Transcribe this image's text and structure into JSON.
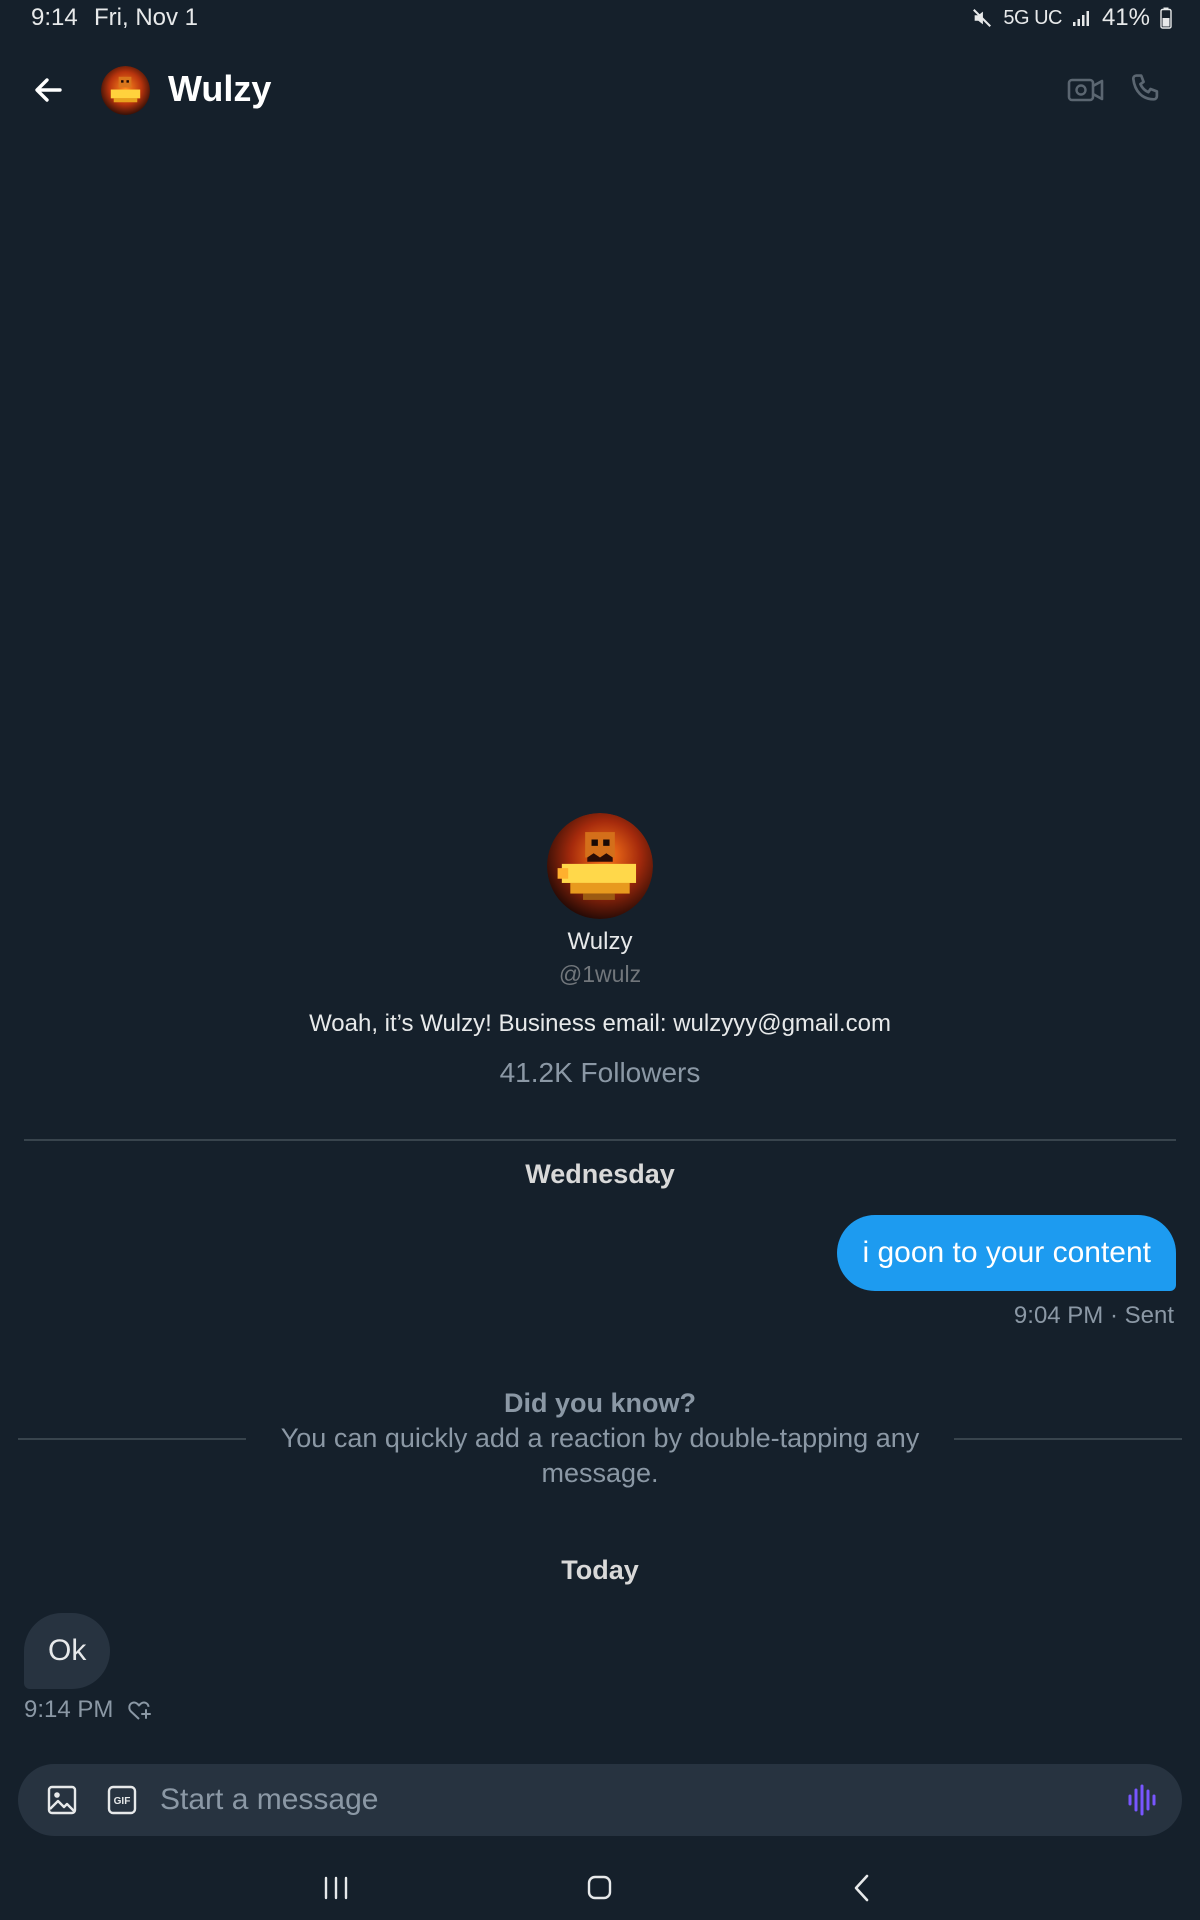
{
  "status_bar": {
    "time": "9:14",
    "date": "Fri, Nov 1",
    "network": "5G UC",
    "battery": "41%",
    "icons": [
      "mute-icon",
      "signal-icon",
      "battery-icon"
    ]
  },
  "header": {
    "title": "Wulzy",
    "icons": [
      "back-arrow-icon",
      "video-camera-icon",
      "phone-icon"
    ]
  },
  "profile": {
    "name": "Wulzy",
    "handle": "@1wulz",
    "bio": "Woah, it’s Wulzy! Business email: wulzyyy@gmail.com",
    "followers": "41.2K Followers"
  },
  "conversation": {
    "day1_label": "Wednesday",
    "sent_message": "i goon to your content",
    "sent_meta": "9:04 PM · Sent",
    "tip_title": "Did you know?",
    "tip_body": "You can quickly add a reaction by double-tapping any message.",
    "day2_label": "Today",
    "received_message": "Ok",
    "received_time": "9:14 PM"
  },
  "composer": {
    "placeholder": "Start a message",
    "icons": [
      "image-icon",
      "gif-icon",
      "voice-icon"
    ]
  },
  "colors": {
    "background": "#15202b",
    "accent": "#1d9bf0",
    "bubble_received": "#273340",
    "voice_icon": "#7856ff",
    "muted_text": "#8b98a5"
  }
}
